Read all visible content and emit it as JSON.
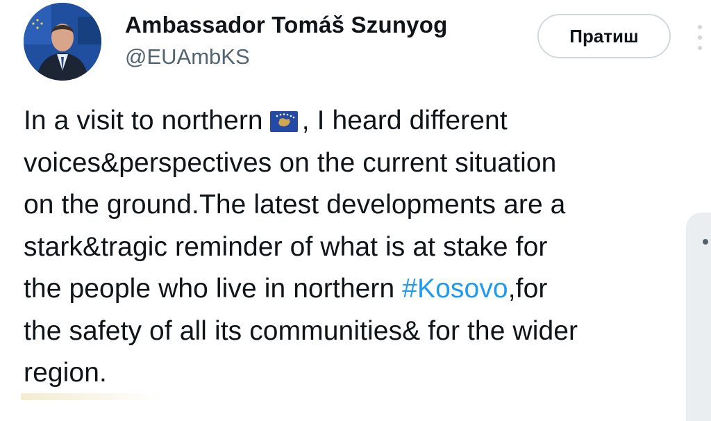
{
  "tweet": {
    "author": {
      "display_name": "Ambassador Tomáš Szunyog",
      "handle": "@EUAmbKS",
      "avatar_icon": "profile-photo-avatar"
    },
    "follow_button": {
      "label": "Пратиш"
    },
    "more_icon": "more-options-dots-icon",
    "body": {
      "line_1_before_flag": "In a visit to northern",
      "flag_icon": "kosovo-flag-emoji",
      "line_1_after_flag": ", I heard different",
      "line_2": "voices&perspectives on the current situation",
      "line_3": "on the ground.The latest developments are a",
      "line_4": "stark&tragic reminder of what is at stake for",
      "line_5_before_hashtag": "the people who live in northern",
      "hashtag": "#Kosovo",
      "line_5_after_hashtag": ",for",
      "line_6": "the safety of all its communities& for the wider",
      "line_7": "region."
    }
  },
  "colors": {
    "text": "#0f1419",
    "secondary_text": "#536471",
    "link": "#1d9bf0",
    "button_border": "#cfd9de",
    "avatar_background": "#1f4f9e",
    "flag_blue": "#244aa5",
    "flag_gold": "#d0a650"
  }
}
